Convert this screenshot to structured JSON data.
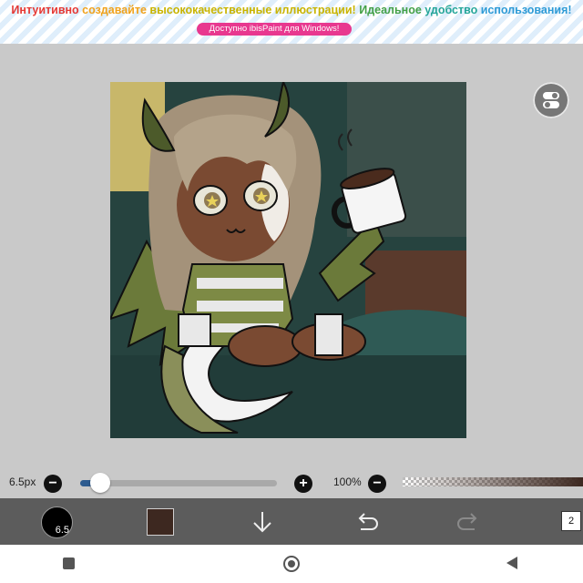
{
  "banner": {
    "segments": [
      {
        "text": "Интуитивно ",
        "color": "#e53935"
      },
      {
        "text": "создавайте ",
        "color": "#f0a21c"
      },
      {
        "text": "высококачественные иллюстрации! ",
        "color": "#c9b400"
      },
      {
        "text": "Идеальное ",
        "color": "#43a047"
      },
      {
        "text": "удобство ",
        "color": "#26a69a"
      },
      {
        "text": "использования!",
        "color": "#2e9bd6"
      }
    ],
    "promo_button": "Доступно ibisPaint для Windows!",
    "promo_color": "#e8388f"
  },
  "canvas": {
    "layer_toggle_icon": "toggle-switch-icon"
  },
  "brush": {
    "size_label": "6.5px",
    "size_fraction": 0.1,
    "opacity_label": "100%",
    "minus_label": "−",
    "plus_label": "+"
  },
  "toolbar": {
    "brush_size_badge": "6.5",
    "color": "#3d2820",
    "layer_count": "2",
    "icons": [
      "brush-size-icon",
      "color-swatch",
      "arrow-down-icon",
      "undo-icon",
      "redo-icon",
      "layers-icon"
    ]
  },
  "navbar": {
    "icons": [
      "recents-square-icon",
      "home-circle-icon",
      "back-triangle-icon"
    ]
  }
}
